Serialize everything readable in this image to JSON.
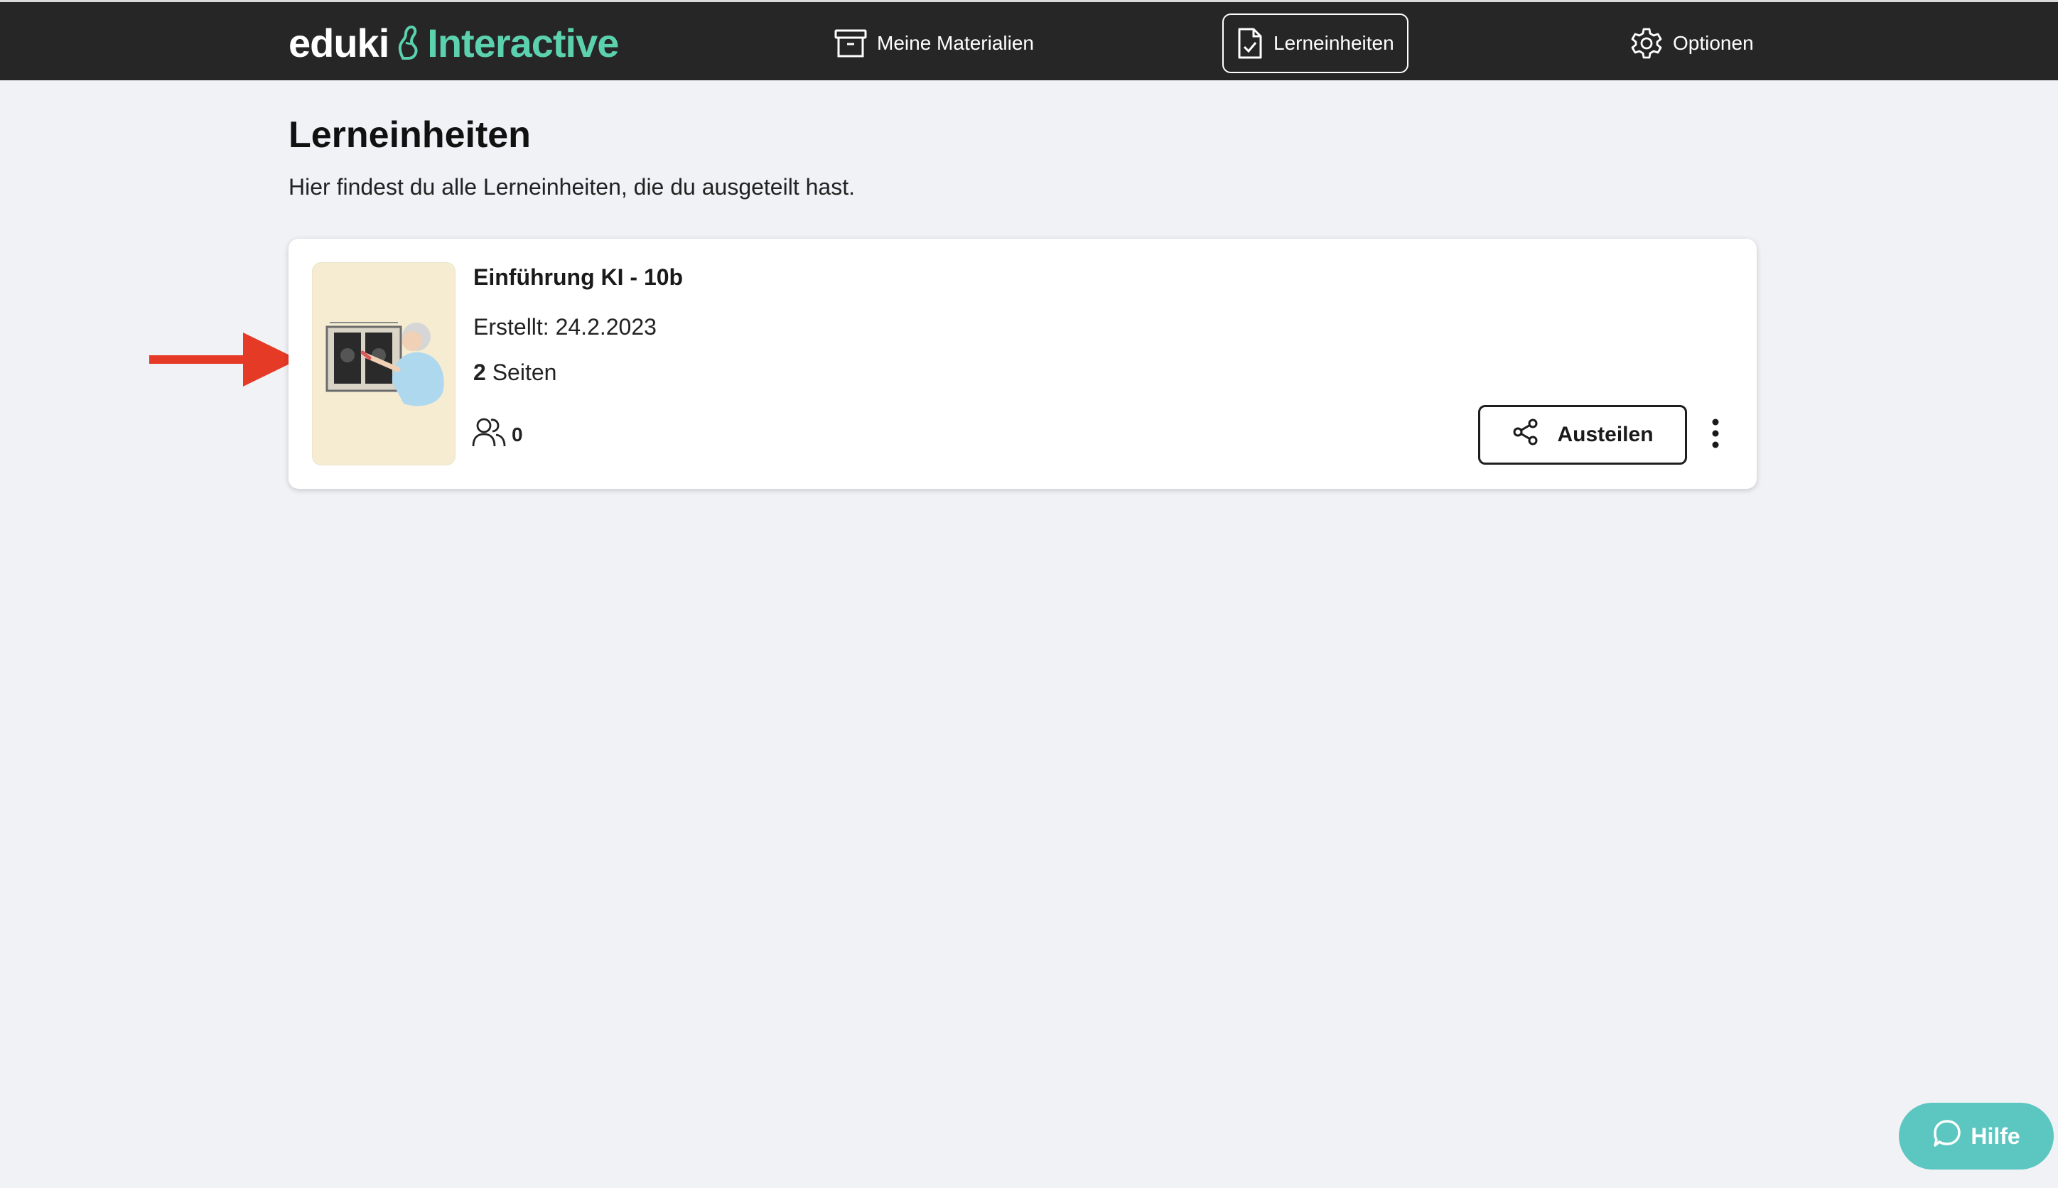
{
  "header": {
    "brand": "eduki",
    "product": "Interactive",
    "nav": {
      "materials": "Meine Materialien",
      "units": "Lerneinheiten",
      "options": "Optionen"
    },
    "active_tab": "Lerneinheiten"
  },
  "main": {
    "title": "Lerneinheiten",
    "subtitle": "Hier findest du alle Lerneinheiten, die du ausgeteilt hast.",
    "units": [
      {
        "title": "Einführung KI - 10b",
        "created": "Erstellt: 24.2.2023",
        "pages_count": "2",
        "pages_label": "Seiten",
        "participants": "0",
        "share_label": "Austeilen"
      }
    ]
  },
  "help": {
    "label": "Hilfe"
  },
  "colors": {
    "header_bg": "#262626",
    "accent_green": "#5cd1ad",
    "help_bg": "#5cc6c0",
    "annotation_arrow": "#e53a26",
    "thumbnail_bg": "#f5ecd2"
  },
  "icons": {
    "logo_mark": "hand-icon",
    "materials": "archive-box-icon",
    "units": "document-check-icon",
    "options": "gear-icon",
    "participants": "users-icon",
    "share": "share-icon",
    "more": "more-vertical-icon",
    "help": "chat-bubble-icon"
  }
}
